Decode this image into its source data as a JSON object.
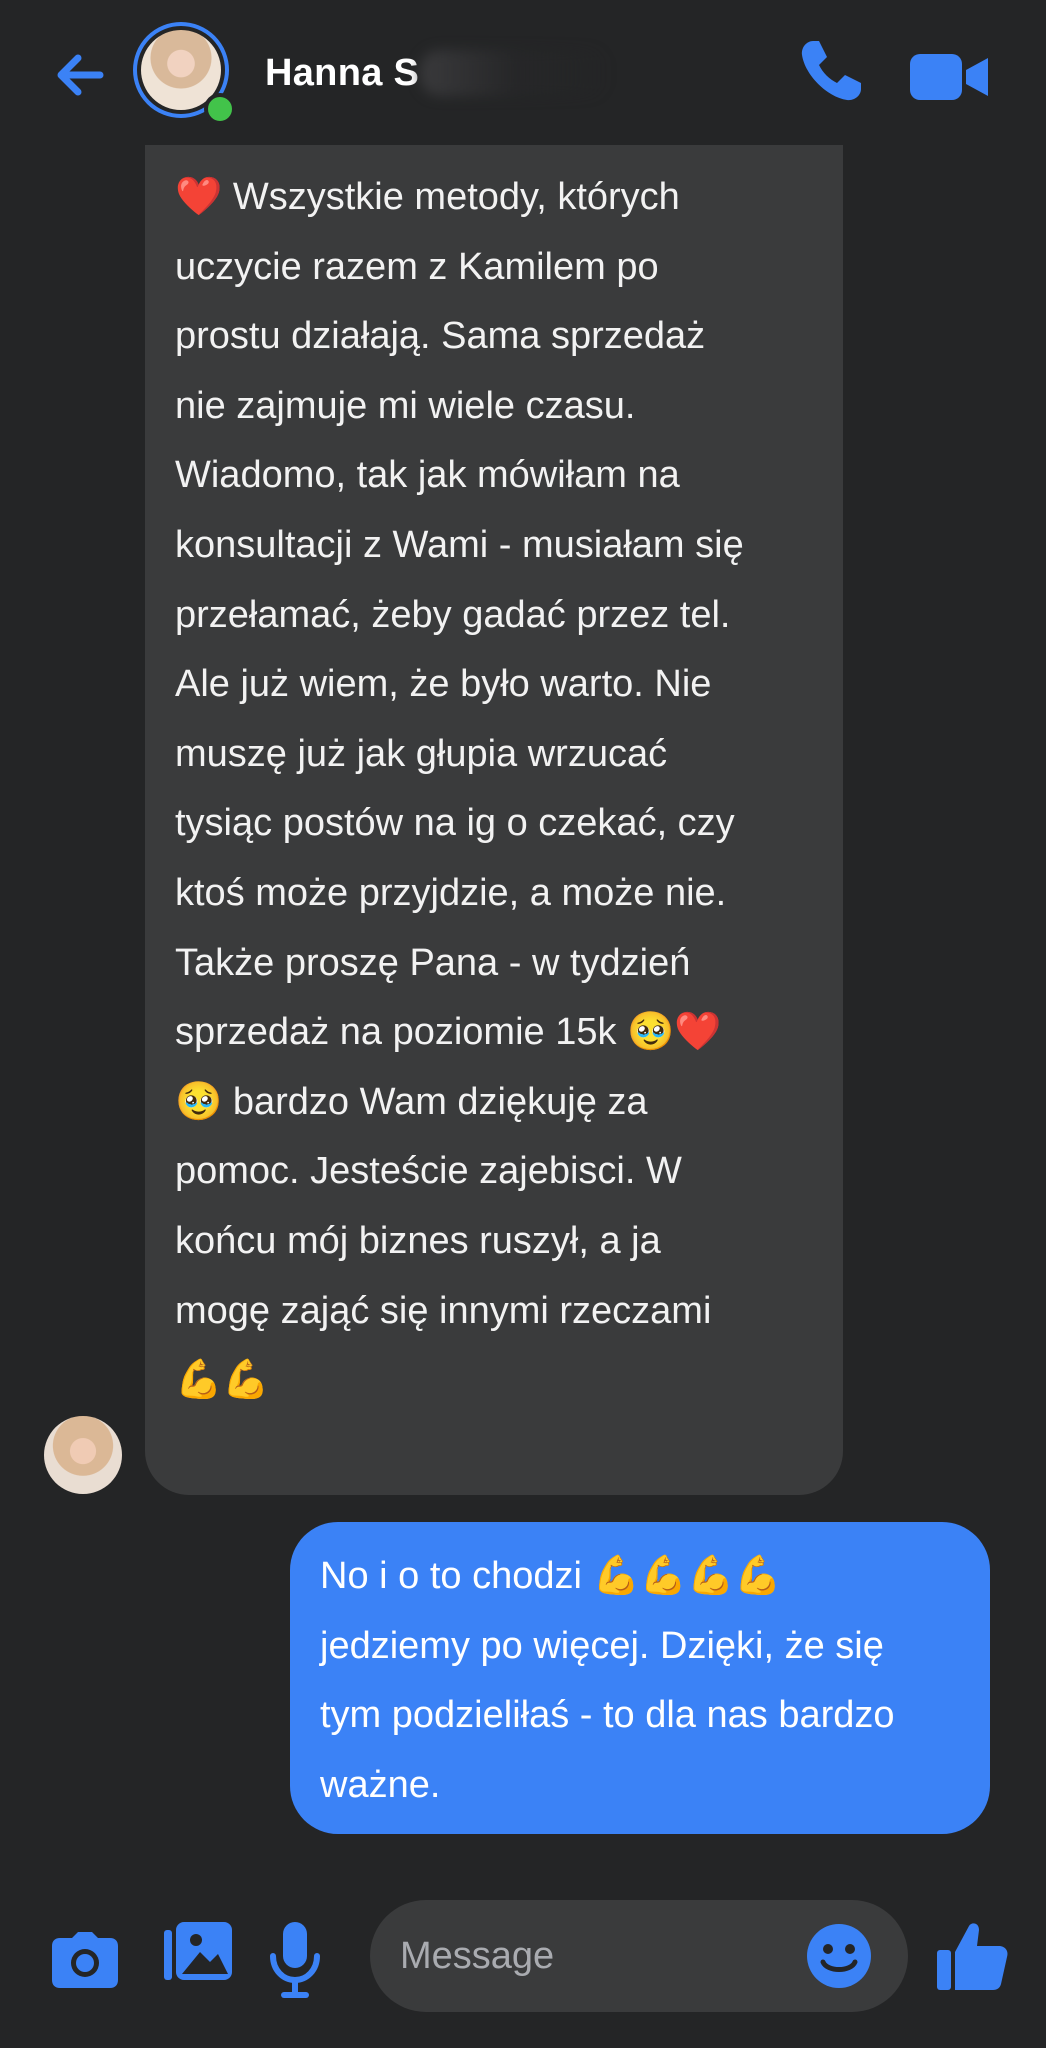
{
  "header": {
    "contact_name": "Hanna S",
    "status": "online"
  },
  "messages": {
    "incoming": [
      "❤️ Wszystkie metody, których",
      "uczycie razem z Kamilem po",
      "prostu działają. Sama sprzedaż",
      "nie zajmuje mi wiele czasu.",
      "Wiadomo, tak jak mówiłam na",
      "konsultacji z Wami - musiałam się",
      "przełamać, żeby gadać przez tel.",
      "Ale już wiem, że było warto. Nie",
      "muszę już jak głupia wrzucać",
      "tysiąc postów na ig o czekać, czy",
      "ktoś może przyjdzie, a może nie.",
      "",
      "Także proszę Pana - w tydzień",
      "sprzedaż na poziomie 15k 🥹❤️",
      "🥹 bardzo Wam dziękuję za",
      "pomoc. Jesteście zajebisci. W",
      "końcu mój biznes ruszył, a ja",
      "mogę zająć się innymi rzeczami",
      "💪💪"
    ],
    "outgoing": [
      "No i o to chodzi 💪💪💪💪",
      "jedziemy po więcej. Dzięki, że się",
      "tym podzieliłaś - to dla nas bardzo",
      "ważne."
    ]
  },
  "composer": {
    "placeholder": "Message"
  },
  "icons": {
    "back": "back-arrow-icon",
    "call": "phone-icon",
    "video": "video-camera-icon",
    "camera": "camera-icon",
    "gallery": "gallery-icon",
    "mic": "microphone-icon",
    "emoji": "emoji-icon",
    "like": "thumbs-up-icon"
  },
  "colors": {
    "accent": "#3b82f6",
    "background": "#242526",
    "incoming_bubble": "#3a3b3c",
    "online": "#42c34a"
  }
}
